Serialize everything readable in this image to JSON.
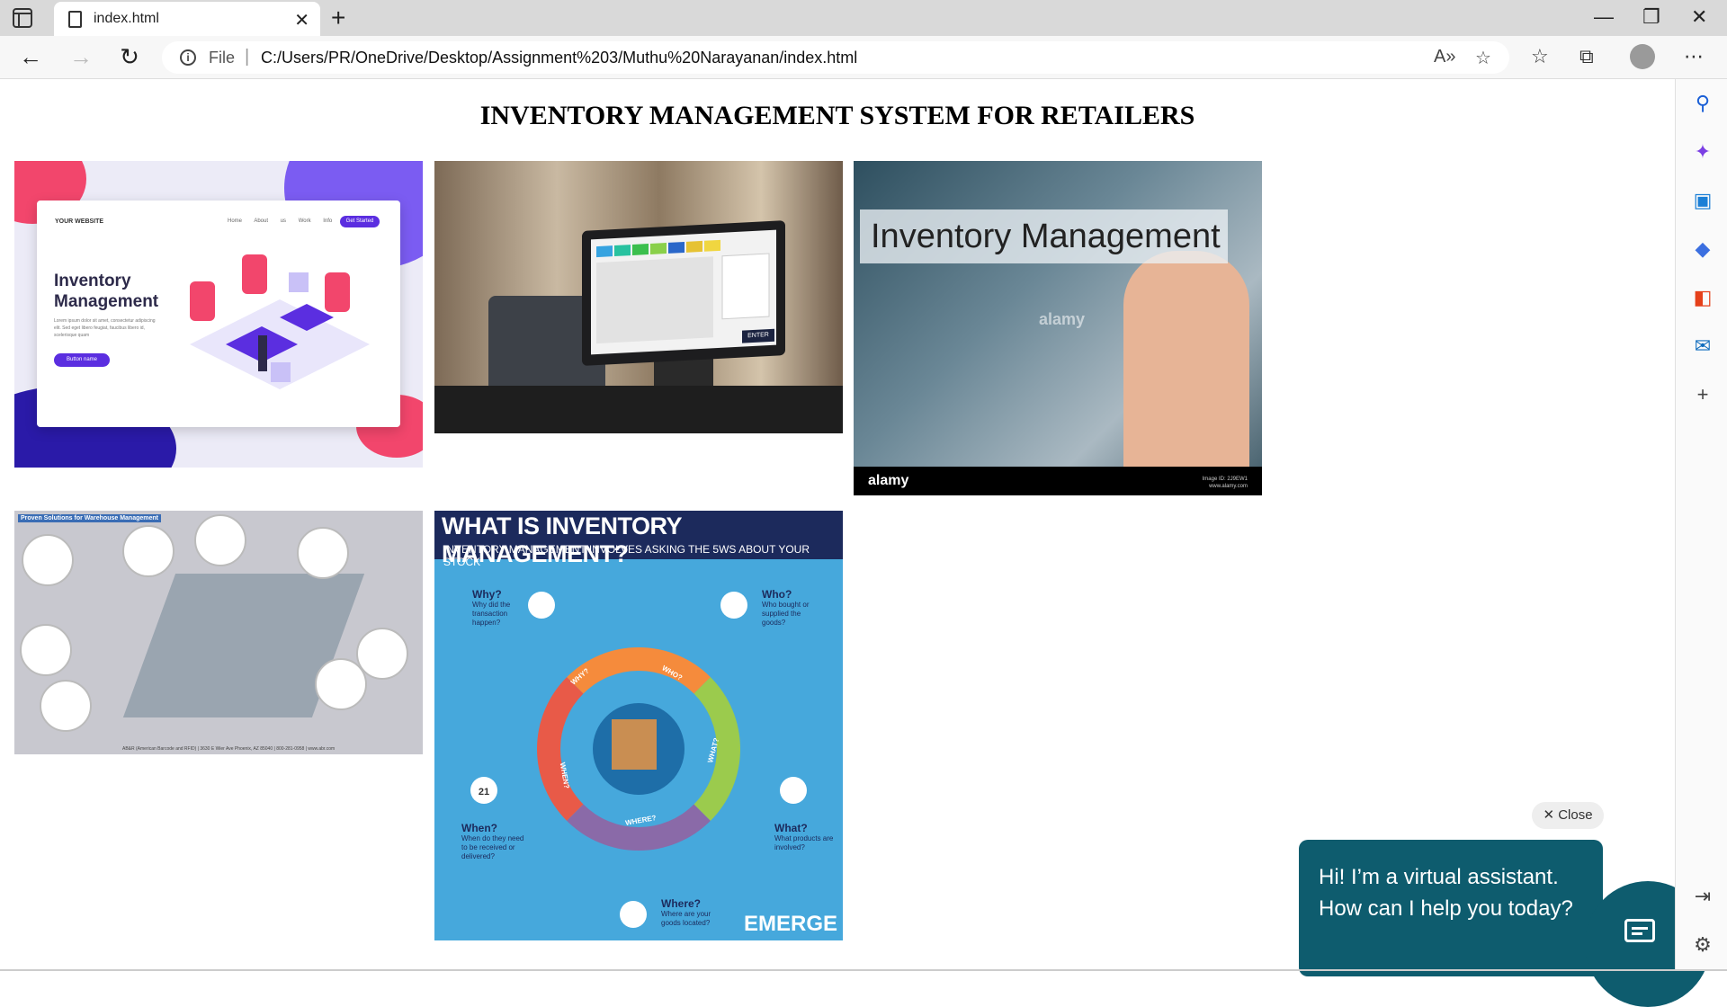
{
  "browser": {
    "tab_title": "index.html",
    "address": {
      "info_label": "File",
      "url": "C:/Users/PR/OneDrive/Desktop/Assignment%203/Muthu%20Narayanan/index.html"
    }
  },
  "page": {
    "title": "INVENTORY MANAGEMENT SYSTEM FOR RETAILERS",
    "images": [
      {
        "name": "inventory-management-illustration",
        "brand": "YOUR WEBSITE",
        "nav": "Home About us Work Info",
        "cta": "Get Started",
        "heading": "Inventory Management",
        "body": "Lorem ipsum dolor sit amet, consectetur adipiscing elit. Sed eget libero feugiat, faucibus libero id, scelerisque quam",
        "button": "Button name"
      },
      {
        "name": "pos-terminal-photo",
        "screen_button": "ENTER"
      },
      {
        "name": "inventory-management-stock-photo",
        "label": "Inventory Management",
        "watermark": "alamy",
        "footer_brand": "alamy",
        "footer_meta_id": "Image ID: 2J9EW1",
        "footer_meta_url": "www.alamy.com"
      },
      {
        "name": "warehouse-solutions-infographic",
        "title": "Proven Solutions for Warehouse Management",
        "footer": "AB&R (American Barcode and RFID) | 3630 E Wier Ave Phoenix, AZ 85040 | 800-281-0958 | www.abr.com"
      },
      {
        "name": "what-is-inventory-management-infographic",
        "title": "WHAT IS INVENTORY MANAGEMENT?",
        "subtitle": "INVENTORY MANAGEMENT INVOLVES ASKING THE 5WS ABOUT YOUR STOCK",
        "questions": [
          {
            "q": "Why?",
            "sub": "Why did the transaction happen?"
          },
          {
            "q": "Who?",
            "sub": "Who bought or supplied the goods?"
          },
          {
            "q": "When?",
            "sub": "When do they need to be received or delivered?"
          },
          {
            "q": "What?",
            "sub": "What products are involved?"
          },
          {
            "q": "Where?",
            "sub": "Where are your goods located?"
          }
        ],
        "ring_labels": [
          "WHY?",
          "WHO?",
          "WHAT?",
          "WHERE?",
          "WHEN?"
        ],
        "calendar_day": "21",
        "brand": "EMERGE"
      }
    ]
  },
  "assistant": {
    "close_label": "Close",
    "message": "Hi! I’m a virtual assistant. How can I help you today?"
  }
}
